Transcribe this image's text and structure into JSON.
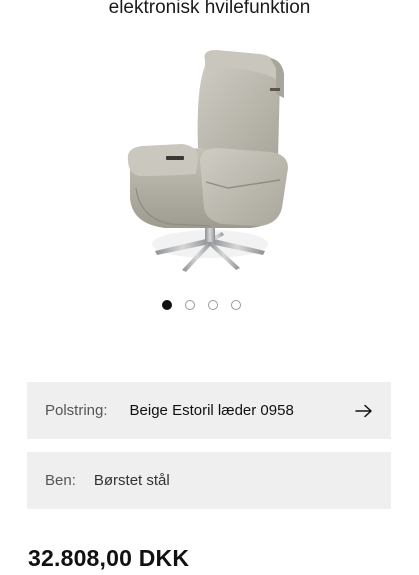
{
  "header": {
    "subtitle": "elektronisk hvilefunktion"
  },
  "gallery": {
    "image_name": "recliner-chair-image",
    "dots": [
      {
        "active": true
      },
      {
        "active": false
      },
      {
        "active": false
      },
      {
        "active": false
      }
    ]
  },
  "options": {
    "upholstery": {
      "label": "Polstring:",
      "value": "Beige Estoril læder 0958",
      "icon": "arrow-right-icon"
    },
    "legs": {
      "label": "Ben:",
      "value": "Børstet stål"
    }
  },
  "price": {
    "text": "32.808,00 DKK"
  },
  "colors": {
    "upholstery": "#b9b6ab",
    "background_row": "#efefef",
    "active_dot": "#111111"
  }
}
